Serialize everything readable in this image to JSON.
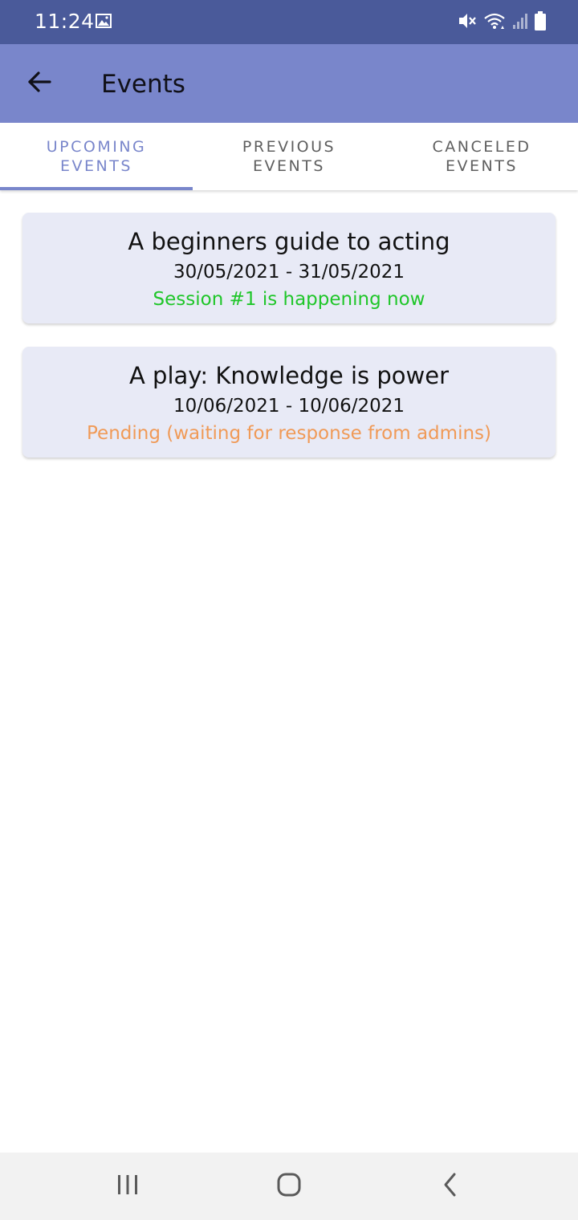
{
  "status_bar": {
    "time": "11:24",
    "icons": [
      "gallery-icon",
      "mute-icon",
      "wifi-icon",
      "signal-icon",
      "battery-icon"
    ]
  },
  "app_bar": {
    "title": "Events",
    "back_icon": "arrow-left-icon",
    "color": "#7986cb"
  },
  "tabs": [
    {
      "label": "UPCOMING\nEVENTS",
      "active": true
    },
    {
      "label": "PREVIOUS\nEVENTS",
      "active": false
    },
    {
      "label": "CANCELED\nEVENTS",
      "active": false
    }
  ],
  "events": [
    {
      "title": "A beginners guide to acting",
      "dates": "30/05/2021 - 31/05/2021",
      "status": "Session #1 is happening now",
      "status_color": "#1fc629"
    },
    {
      "title": "A play: Knowledge is power",
      "dates": "10/06/2021 - 10/06/2021",
      "status": "Pending (waiting for response from admins)",
      "status_color": "#f09a57"
    }
  ],
  "nav_bar": {
    "icons": [
      "recent-apps-icon",
      "home-icon",
      "back-icon"
    ]
  }
}
